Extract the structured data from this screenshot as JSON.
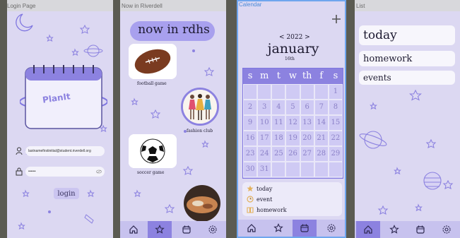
{
  "screens": {
    "login": {
      "frame_label": "Login Page",
      "logo_text": "PlanIt",
      "email_value": "lastnamefirstinitial@student.riverdell.org",
      "password_mask": "••••••",
      "login_label": "login"
    },
    "news": {
      "frame_label": "Now in Riverdell",
      "title": "now in rdhs",
      "items": [
        {
          "caption": "football game"
        },
        {
          "caption": "fashion club"
        },
        {
          "caption": "soccer game"
        }
      ]
    },
    "calendar": {
      "frame_label": "Calendar",
      "year_text": "< 2022 >",
      "month": "january",
      "day": "16th",
      "weekdays": [
        "s",
        "m",
        "t",
        "w",
        "th",
        "f",
        "s"
      ],
      "days": [
        [
          "",
          "",
          "",
          "",
          "",
          "",
          "1"
        ],
        [
          "2",
          "3",
          "4",
          "5",
          "6",
          "7",
          "8"
        ],
        [
          "9",
          "10",
          "11",
          "12",
          "13",
          "14",
          "15"
        ],
        [
          "16",
          "17",
          "18",
          "19",
          "20",
          "21",
          "22"
        ],
        [
          "23",
          "24",
          "25",
          "26",
          "27",
          "28",
          "29"
        ],
        [
          "30",
          "31",
          "",
          "",
          "",
          "",
          ""
        ]
      ],
      "legend": [
        "today",
        "event",
        "homework"
      ]
    },
    "list": {
      "frame_label": "List",
      "items": [
        "today",
        "homework",
        "events"
      ]
    }
  },
  "nav": [
    "home-icon",
    "star-icon",
    "calendar-icon",
    "settings-icon"
  ],
  "colors": {
    "background": "#dcd8f2",
    "accent": "#8c82e0",
    "moon": "#e3b15c",
    "text": "#1d1a30"
  }
}
